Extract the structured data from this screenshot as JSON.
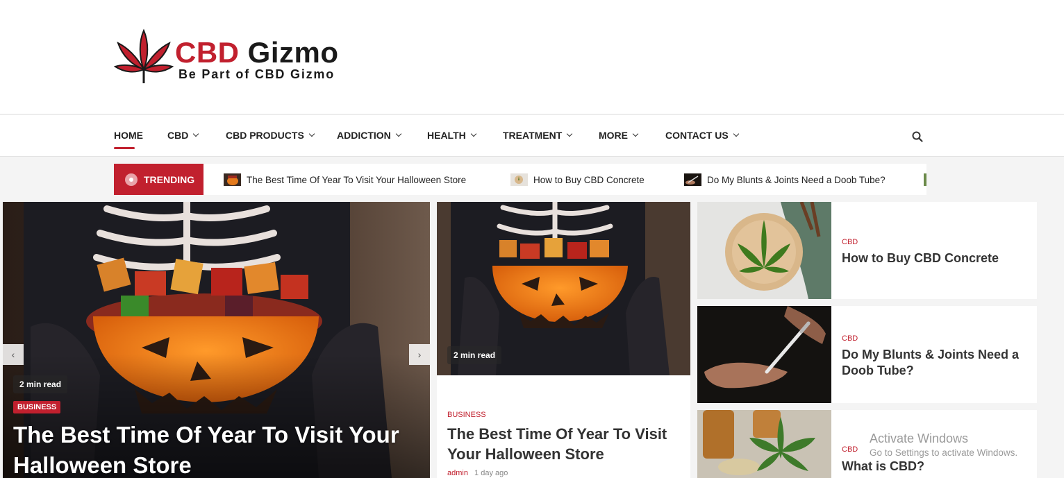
{
  "brand": {
    "name_part1": "CBD",
    "name_part2": "Gizmo",
    "tagline": "Be Part of CBD Gizmo",
    "accent_color": "#c1202e"
  },
  "nav": {
    "items": [
      {
        "label": "HOME",
        "active": true,
        "has_dropdown": false
      },
      {
        "label": "CBD",
        "has_dropdown": true
      },
      {
        "label": "CBD PRODUCTS",
        "has_dropdown": true
      },
      {
        "label": "ADDICTION",
        "has_dropdown": true
      },
      {
        "label": "HEALTH",
        "has_dropdown": true
      },
      {
        "label": "TREATMENT",
        "has_dropdown": true
      },
      {
        "label": "MORE",
        "has_dropdown": true
      },
      {
        "label": "CONTACT US",
        "has_dropdown": true
      }
    ],
    "search_icon": "search-icon"
  },
  "trending": {
    "label": "TRENDING",
    "items": [
      {
        "title": "The Best Time Of Year To Visit Your Halloween Store"
      },
      {
        "title": "How to Buy CBD Concrete"
      },
      {
        "title": "Do My Blunts & Joints Need a Doob Tube?"
      }
    ]
  },
  "slider": {
    "read_time": "2 min read",
    "category": "BUSINESS",
    "title": "The Best Time Of Year To Visit Your Halloween Store",
    "prev_icon": "chevron-left-icon",
    "next_icon": "chevron-right-icon"
  },
  "featured": {
    "read_time": "2 min read",
    "category": "BUSINESS",
    "title": "The Best Time Of Year To Visit Your Halloween Store",
    "author": "admin",
    "date": "1 day ago"
  },
  "side_posts": [
    {
      "category": "CBD",
      "title": "How to Buy CBD Concrete"
    },
    {
      "category": "CBD",
      "title": "Do My Blunts & Joints Need a Doob Tube?"
    },
    {
      "category": "CBD",
      "title": "What is CBD?"
    }
  ],
  "os_watermark": {
    "line1": "Activate Windows",
    "line2": "Go to Settings to activate Windows."
  }
}
